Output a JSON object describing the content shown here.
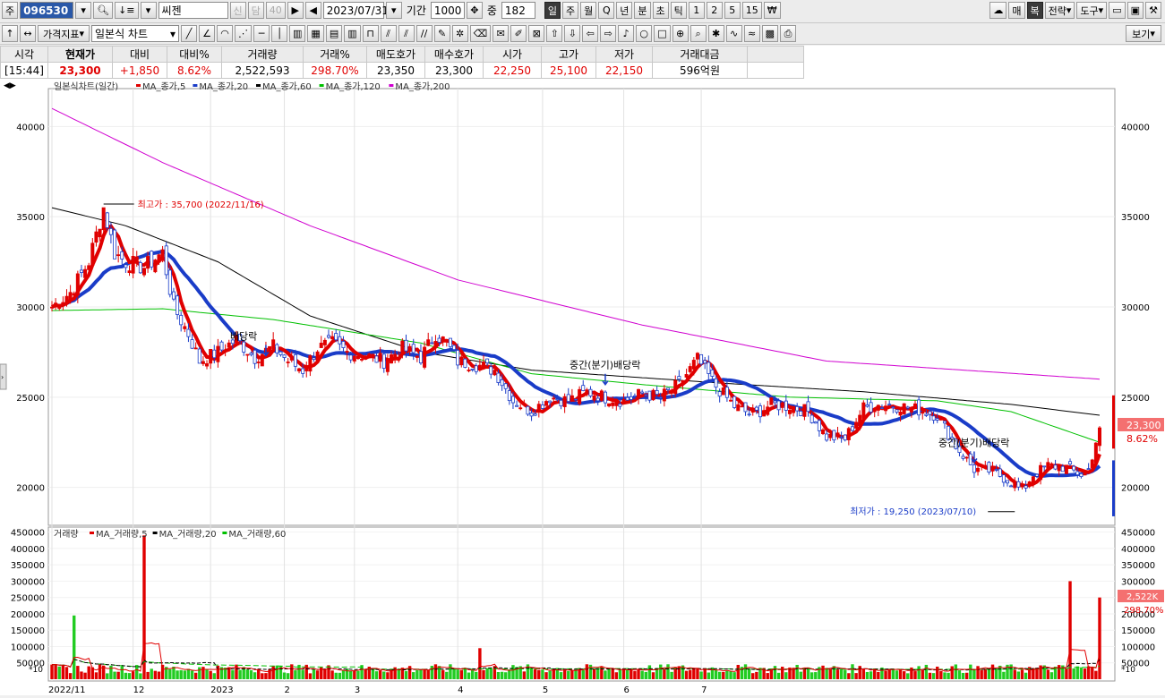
{
  "toolbar1": {
    "stock_type": "주",
    "stock_code": "096530",
    "stock_name": "씨젠",
    "credit_badges": [
      "신",
      "담",
      "40"
    ],
    "date": "2023/07/31",
    "period_label": "기간",
    "period_value": "1000",
    "mid_label": "중",
    "mid_value": "182",
    "timeframes": [
      "일",
      "주",
      "월",
      "Q",
      "년",
      "분",
      "초",
      "틱",
      "1",
      "2",
      "5",
      "15",
      "₩"
    ],
    "right_buttons": [
      "매",
      "복",
      "전략",
      "도구"
    ]
  },
  "toolbar2": {
    "indicator_button": "가격지표",
    "chart_type": "일본식 차트",
    "view_button": "보기"
  },
  "quote": {
    "headers": [
      "시각",
      "현재가",
      "대비",
      "대비%",
      "거래량",
      "거래%",
      "매도호가",
      "매수호가",
      "시가",
      "고가",
      "저가",
      "거래대금"
    ],
    "values": [
      "[15:44]",
      "23,300",
      "+1,850",
      "8.62%",
      "2,522,593",
      "298.70%",
      "23,350",
      "23,300",
      "22,250",
      "25,100",
      "22,150",
      "596억원"
    ]
  },
  "colors": {
    "up": "#e00000",
    "down": "#1a3cc8",
    "ma5": "#e00000",
    "ma20": "#1a3cc8",
    "ma60": "#000000",
    "ma120": "#00c000",
    "ma200": "#d000d0",
    "vol_up": "#e00000",
    "vol_down": "#22cc22"
  },
  "chart_data": [
    {
      "type": "candlestick",
      "title": "일본식차트(일간)",
      "legend": [
        {
          "name": "MA_종가,5",
          "color": "#e00000"
        },
        {
          "name": "MA_종가,20",
          "color": "#1a3cc8"
        },
        {
          "name": "MA_종가,60",
          "color": "#000000"
        },
        {
          "name": "MA_종가,120",
          "color": "#00c000"
        },
        {
          "name": "MA_종가,200",
          "color": "#d000d0"
        }
      ],
      "ylim": [
        18000,
        42000
      ],
      "yticks": [
        20000,
        25000,
        30000,
        35000,
        40000
      ],
      "xticks": [
        "2022/11",
        "12",
        "2023",
        "2",
        "3",
        "4",
        "5",
        "6",
        "7"
      ],
      "close_keypoints": [
        [
          0,
          30000
        ],
        [
          5,
          30800
        ],
        [
          10,
          32500
        ],
        [
          14,
          35500
        ],
        [
          17,
          33000
        ],
        [
          20,
          32500
        ],
        [
          25,
          32200
        ],
        [
          30,
          33000
        ],
        [
          33,
          30000
        ],
        [
          37,
          28500
        ],
        [
          40,
          27000
        ],
        [
          45,
          27500
        ],
        [
          50,
          28200
        ],
        [
          55,
          27200
        ],
        [
          60,
          27800
        ],
        [
          64,
          27000
        ],
        [
          68,
          26500
        ],
        [
          72,
          27700
        ],
        [
          76,
          28000
        ],
        [
          80,
          27500
        ],
        [
          85,
          27300
        ],
        [
          90,
          27000
        ],
        [
          95,
          27700
        ],
        [
          100,
          27200
        ],
        [
          104,
          28500
        ],
        [
          107,
          28000
        ],
        [
          110,
          27000
        ],
        [
          115,
          26800
        ],
        [
          120,
          26500
        ],
        [
          125,
          24800
        ],
        [
          130,
          24200
        ],
        [
          135,
          25000
        ],
        [
          140,
          24800
        ],
        [
          145,
          25300
        ],
        [
          150,
          25000
        ],
        [
          155,
          24800
        ],
        [
          160,
          25200
        ],
        [
          165,
          25000
        ],
        [
          170,
          25700
        ],
        [
          175,
          27100
        ],
        [
          180,
          25600
        ],
        [
          185,
          24500
        ],
        [
          190,
          24000
        ],
        [
          195,
          24600
        ],
        [
          200,
          24500
        ],
        [
          205,
          24200
        ],
        [
          210,
          22800
        ],
        [
          215,
          22700
        ],
        [
          220,
          24400
        ],
        [
          225,
          24600
        ],
        [
          230,
          24500
        ],
        [
          235,
          24300
        ],
        [
          240,
          24000
        ],
        [
          245,
          22300
        ],
        [
          250,
          21000
        ],
        [
          255,
          20900
        ],
        [
          260,
          20300
        ],
        [
          263,
          19800
        ],
        [
          266,
          20700
        ],
        [
          270,
          21200
        ],
        [
          275,
          21100
        ],
        [
          279,
          20700
        ],
        [
          281,
          21000
        ],
        [
          284,
          23300
        ]
      ],
      "ma200_keypoints": [
        [
          0,
          41000
        ],
        [
          30,
          38000
        ],
        [
          70,
          34500
        ],
        [
          110,
          31500
        ],
        [
          160,
          29000
        ],
        [
          210,
          27000
        ],
        [
          284,
          26000
        ]
      ],
      "ma60_keypoints": [
        [
          0,
          35500
        ],
        [
          20,
          34500
        ],
        [
          45,
          32500
        ],
        [
          70,
          29500
        ],
        [
          100,
          27500
        ],
        [
          130,
          26500
        ],
        [
          180,
          25800
        ],
        [
          220,
          25300
        ],
        [
          260,
          24600
        ],
        [
          284,
          24000
        ]
      ],
      "ma120_keypoints": [
        [
          0,
          29800
        ],
        [
          30,
          29900
        ],
        [
          60,
          29300
        ],
        [
          100,
          28000
        ],
        [
          130,
          26300
        ],
        [
          160,
          25700
        ],
        [
          200,
          25000
        ],
        [
          240,
          24800
        ],
        [
          260,
          24200
        ],
        [
          284,
          22500
        ]
      ],
      "annotations": [
        {
          "label": "최고가 : 35,700 (2022/11/16)",
          "index": 14,
          "price": 35700,
          "color": "#e00000"
        },
        {
          "label": "최저가 : 19,250 (2023/07/10)",
          "index": 261,
          "price": 19250,
          "color": "#1a3cc8"
        },
        {
          "label": "배당락",
          "index": 58,
          "price": 27200,
          "color": "#000000"
        },
        {
          "label": "중간(분기)배당락",
          "index": 150,
          "price": 25600,
          "color": "#000000"
        },
        {
          "label": "중간(분기)배당락",
          "index": 250,
          "price": 21300,
          "color": "#000000"
        }
      ],
      "last_price_label": "23,300",
      "last_change_label": "8.62%"
    },
    {
      "type": "bar",
      "title": "거래량",
      "legend": [
        {
          "name": "MA_거래량,5",
          "color": "#e00000"
        },
        {
          "name": "MA_거래량,20",
          "color": "#000000"
        },
        {
          "name": "MA_거래량,60",
          "color": "#00c000"
        }
      ],
      "ylim": [
        0,
        460000
      ],
      "yticks": [
        50000,
        100000,
        150000,
        200000,
        250000,
        300000,
        350000,
        400000,
        450000
      ],
      "unit_label": "*10",
      "spikes": [
        [
          6,
          195000
        ],
        [
          25,
          440000
        ],
        [
          116,
          95000
        ],
        [
          276,
          300000
        ],
        [
          284,
          250000
        ]
      ],
      "last_volume_label": "2,522K",
      "last_pct_label": "298.70%"
    }
  ]
}
